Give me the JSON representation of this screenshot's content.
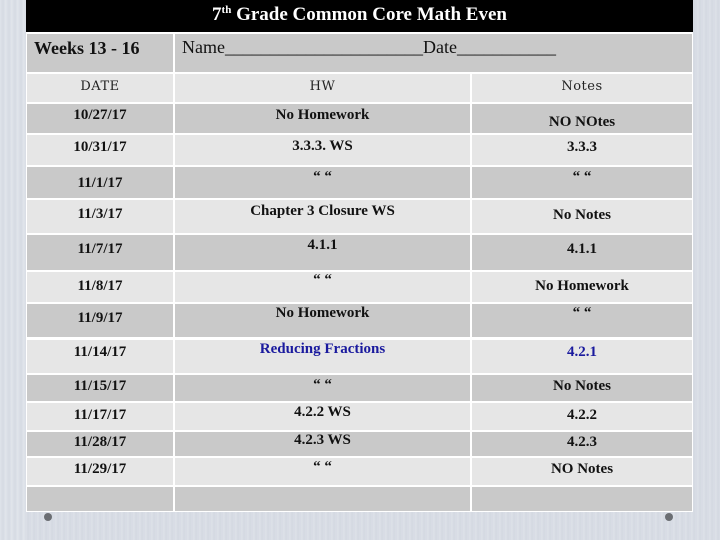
{
  "title": {
    "main": "7",
    "sup": "th",
    "rest": " Grade Common Core Math Even"
  },
  "weeks_label": "Weeks 13 - 16",
  "name_date_line": "Name______________________Date___________",
  "columns": [
    "DATE",
    "HW",
    "Notes"
  ],
  "rows": [
    {
      "date": "10/27/17",
      "hw": "No Homework",
      "notes": "NO NOtes"
    },
    {
      "date": "10/31/17",
      "hw": "3.3.3. WS",
      "notes": "3.3.3"
    },
    {
      "date": "11/1/17",
      "hw": "“  “",
      "notes": "“  “"
    },
    {
      "date": "11/3/17",
      "hw": "Chapter 3 Closure WS",
      "notes": "No Notes"
    },
    {
      "date": "11/7/17",
      "hw": "4.1.1",
      "notes": "4.1.1"
    },
    {
      "date": "11/8/17",
      "hw": "“  “",
      "notes": "No Homework"
    },
    {
      "date": "11/9/17",
      "hw": "No Homework",
      "notes": "“  “"
    },
    {
      "date": "11/14/17",
      "hw": "Reducing Fractions",
      "notes": "4.2.1"
    },
    {
      "date": "11/15/17",
      "hw": "“  “",
      "notes": "No Notes"
    },
    {
      "date": "11/17/17",
      "hw": "4.2.2 WS",
      "notes": "4.2.2"
    },
    {
      "date": "11/28/17",
      "hw": "4.2.3 WS",
      "notes": "4.2.3"
    },
    {
      "date": "11/29/17",
      "hw": "“  “",
      "notes": "NO Notes"
    },
    {
      "date": "",
      "hw": "",
      "notes": ""
    }
  ],
  "colors": {
    "title_bg": "#000000",
    "dark_row": "#c9c9c9",
    "light_row": "#e6e6e6",
    "highlight_text": "#1a1a9e"
  }
}
